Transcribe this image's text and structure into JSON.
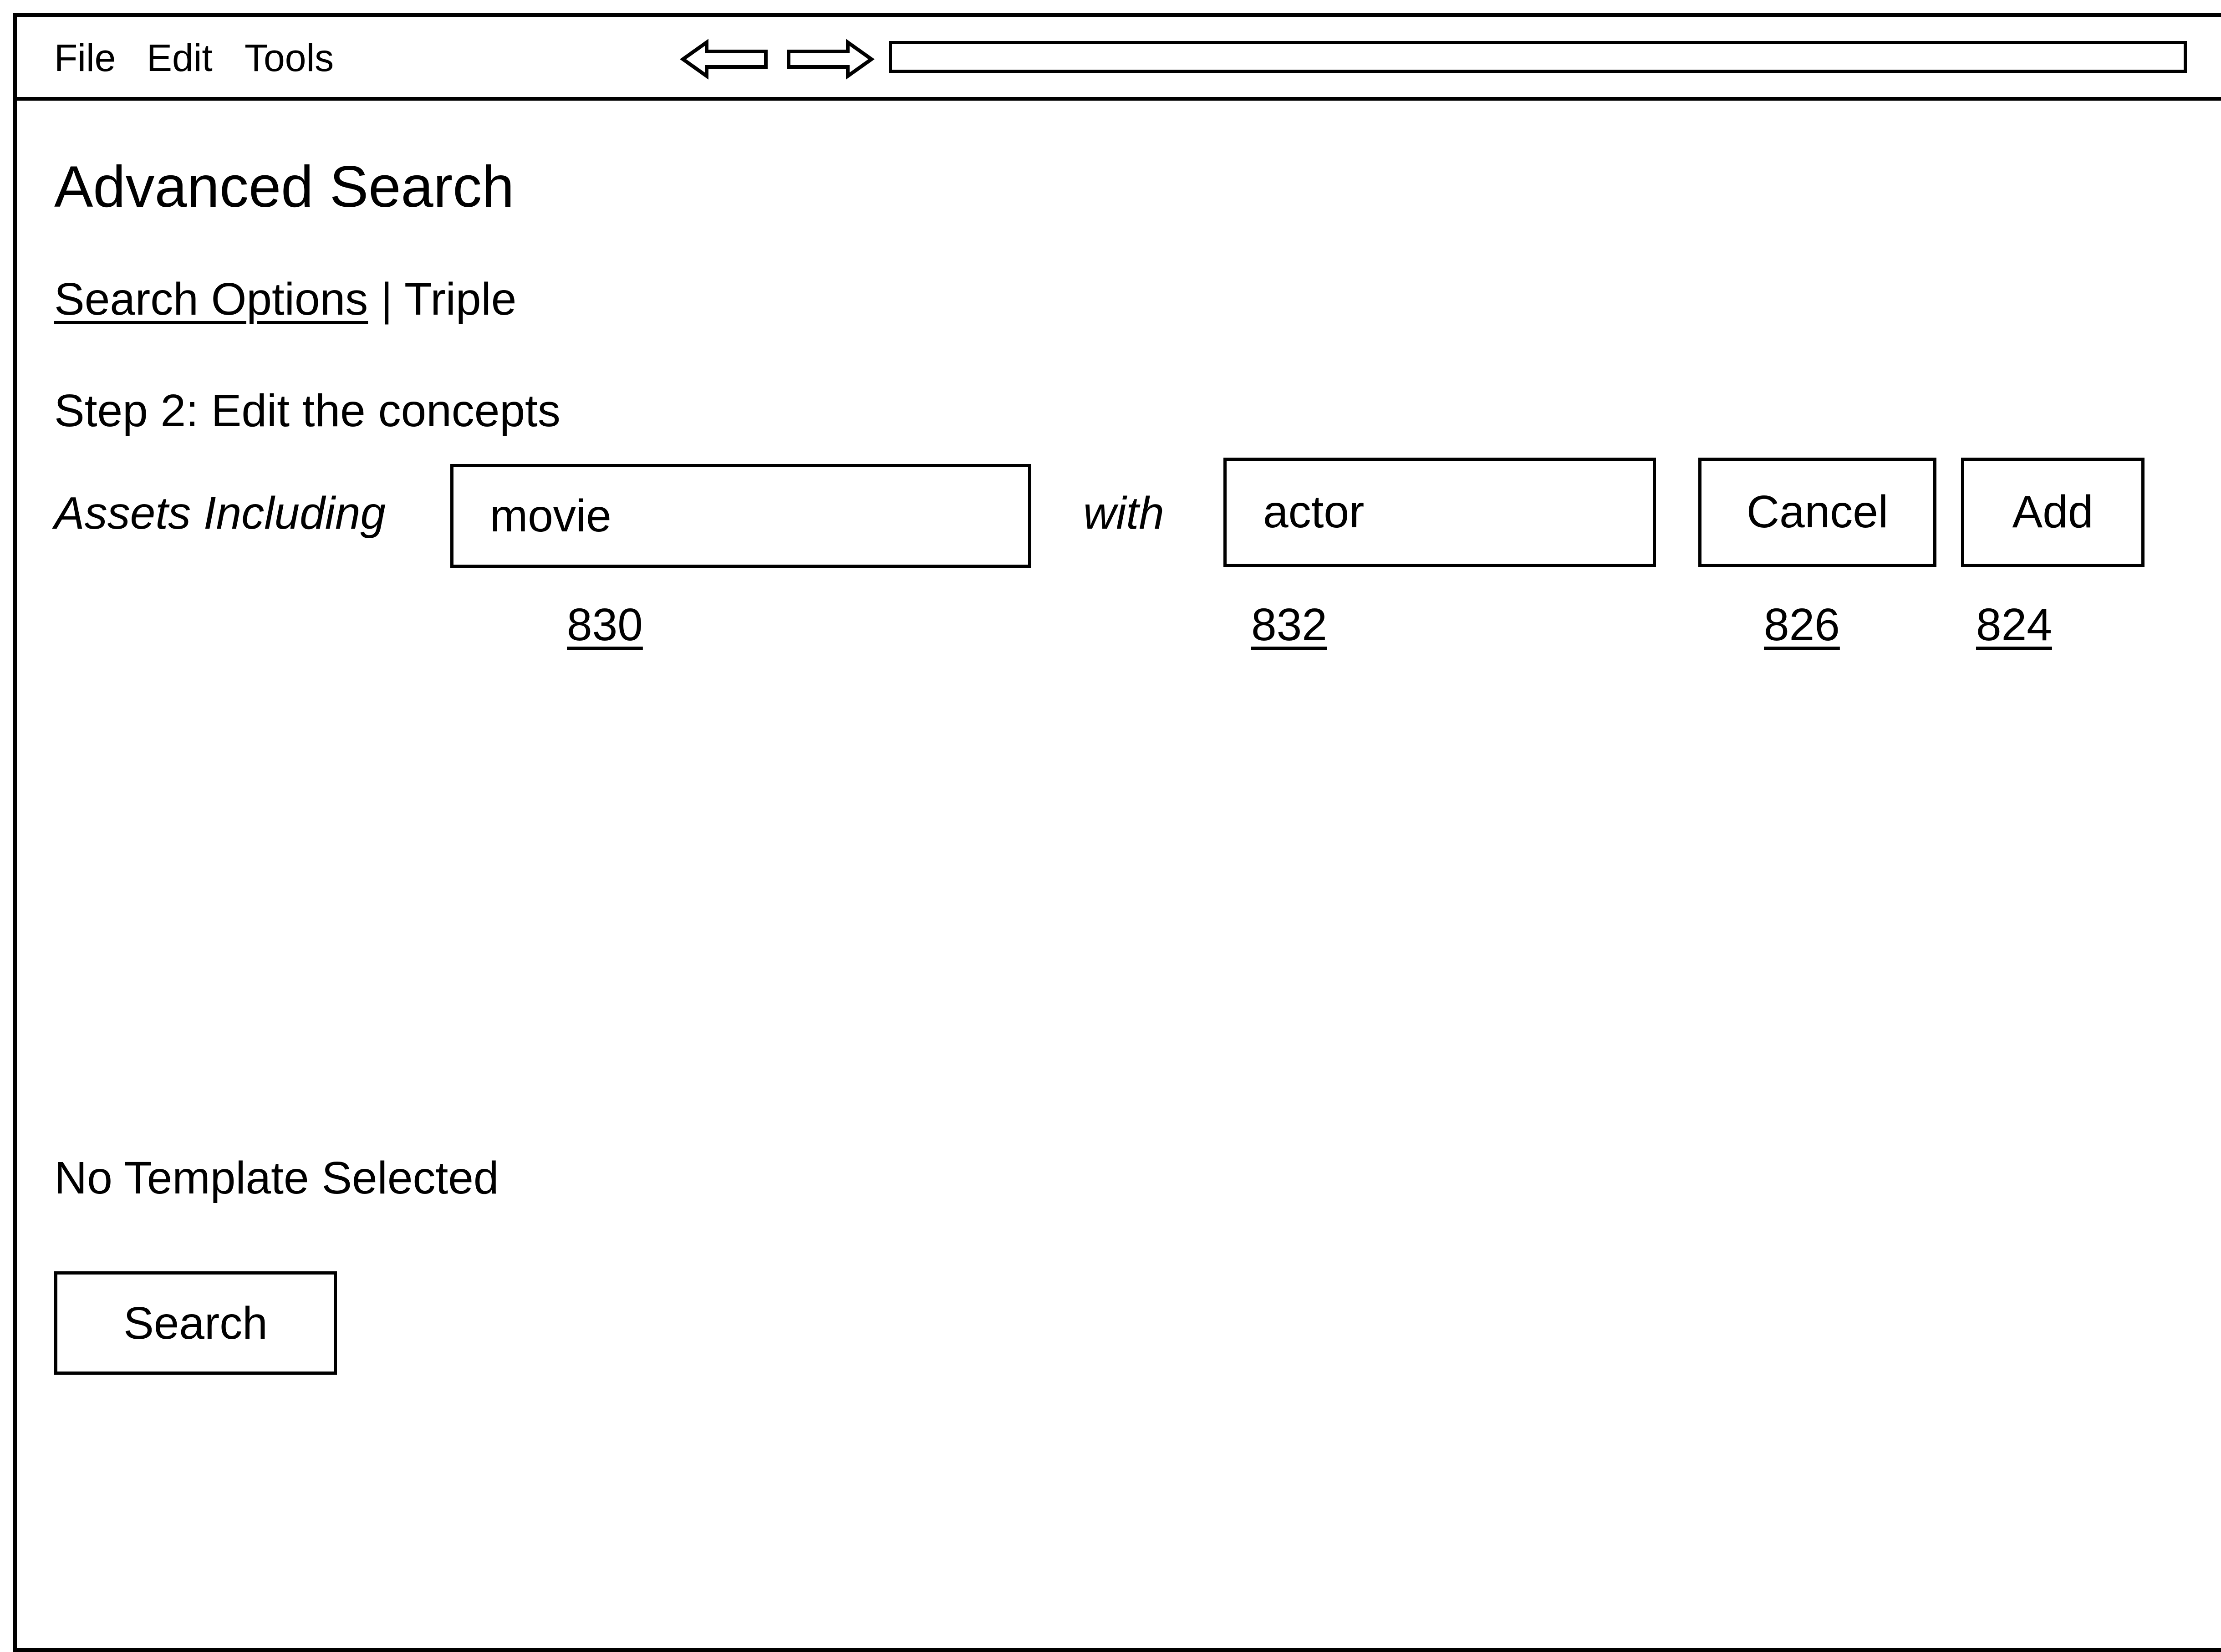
{
  "menubar": {
    "file_label": "File",
    "edit_label": "Edit",
    "tools_label": "Tools"
  },
  "page": {
    "title": "Advanced Search",
    "breadcrumb": {
      "link_label": "Search Options",
      "separator": "|",
      "current_label": "Triple"
    },
    "step_label": "Step 2: Edit the concepts"
  },
  "concept_editor": {
    "subject_label": "Assets Including",
    "subject_value": "movie",
    "connector_label": "with",
    "object_value": "actor",
    "cancel_label": "Cancel",
    "add_label": "Add",
    "reference_numerals": {
      "subject_field": "830",
      "object_field": "832",
      "cancel_button": "826",
      "add_button": "824"
    }
  },
  "template_status": "No Template Selected",
  "search_button_label": "Search"
}
